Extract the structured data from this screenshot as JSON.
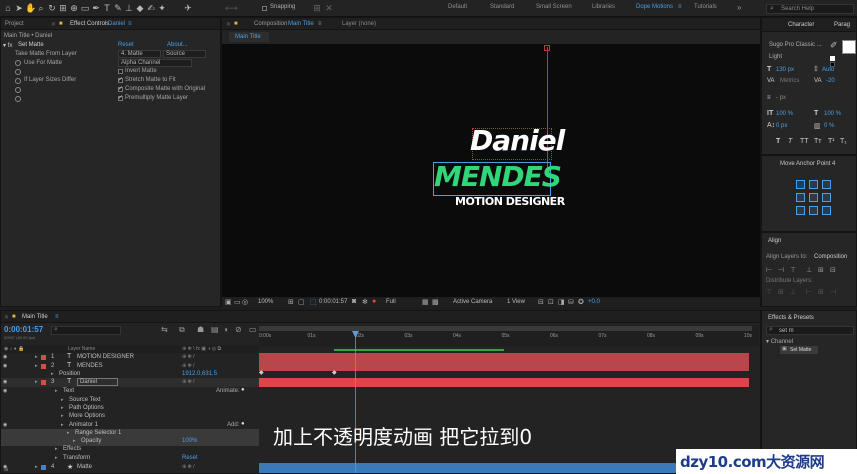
{
  "toolbar": {
    "snapping": "Snapping",
    "workspaces": [
      "Default",
      "Standard",
      "Small Screen",
      "Libraries",
      "Dope Motions",
      "Tutorials"
    ],
    "active_workspace": "Dope Motions",
    "search_placeholder": "Search Help"
  },
  "project_panel": {
    "tab": "Project"
  },
  "effect_controls": {
    "tab_prefix": "Effect Controls",
    "tab_layer": "Daniel",
    "breadcrumb": "Main Title • Daniel",
    "effect_name": "Set Matte",
    "reset": "Reset",
    "about": "About...",
    "take_matte_label": "Take Matte From Layer",
    "take_matte_value": "4. Matte",
    "take_matte_source": "Source",
    "use_for_matte_label": "Use For Matte",
    "use_for_matte_value": "Alpha Channel",
    "invert_matte": "Invert Matte",
    "if_layer_sizes_differ": "If Layer Sizes Differ",
    "stretch_matte": "Stretch Matte to Fit",
    "composite_matte": "Composite Matte with Original",
    "premultiply": "Premultiply Matte Layer"
  },
  "composition": {
    "tab_prefix": "Composition",
    "tab_name": "Main Title",
    "layer_tab": "Layer (none)",
    "sub_tab": "Main Title",
    "title_line1": "Daniel",
    "title_line2": "MENDES",
    "title_line3": "MOTION DESIGNER",
    "zoom": "100%",
    "timecode": "0:00:01:57",
    "resolution": "Full",
    "camera": "Active Camera",
    "view": "1 View",
    "exposure": "+0.0"
  },
  "character": {
    "tab": "Character",
    "tab2": "Parag",
    "font": "Sugo Pro Classic ...",
    "style": "Light",
    "size": "130 px",
    "leading": "Auto",
    "tracking": "-20",
    "kerning_label": "Metrics",
    "stroke_unit": "- px",
    "vscale": "100 %",
    "hscale": "100 %",
    "baseline": "0 px",
    "tsume": "0 %",
    "styles": [
      "T",
      "T",
      "TT",
      "Tт",
      "T¹",
      "T₁"
    ]
  },
  "move_anchor": {
    "title": "Move Anchor Point 4"
  },
  "align": {
    "tab": "Align",
    "align_to_label": "Align Layers to:",
    "align_to_value": "Composition",
    "distribute": "Distribute Layers:"
  },
  "effects_presets": {
    "tab": "Effects & Presets",
    "search_value": "set m",
    "category": "Channel",
    "item": "Set Matte"
  },
  "timeline": {
    "tab": "Main Title",
    "timecode": "0:00:01:57",
    "frame_info": "00097 (60.00 fps)",
    "ruler_labels": [
      "0:00s",
      "01s",
      "02s",
      "03s",
      "04s",
      "05s",
      "06s",
      "07s",
      "08s",
      "09s",
      "10s"
    ],
    "col_layer_name": "Layer Name",
    "layers": [
      {
        "num": "1",
        "name": "MOTION DESIGNER",
        "label_color": "#d94b4b"
      },
      {
        "num": "2",
        "name": "MENDES",
        "label_color": "#d94b4b"
      },
      {
        "num": "",
        "name": "Position",
        "value": "1912.0,631.5"
      },
      {
        "num": "3",
        "name": "Daniel",
        "label_color": "#d94b4b"
      },
      {
        "num": "",
        "name": "Text",
        "animate": "Animate:"
      },
      {
        "num": "",
        "name": "Source Text"
      },
      {
        "num": "",
        "name": "Path Options"
      },
      {
        "num": "",
        "name": "More Options"
      },
      {
        "num": "",
        "name": "Animator 1",
        "add": "Add:"
      },
      {
        "num": "",
        "name": "Range Selector 1"
      },
      {
        "num": "",
        "name": "Opacity",
        "value": "100%"
      },
      {
        "num": "",
        "name": "Effects"
      },
      {
        "num": "",
        "name": "Transform",
        "reset": "Reset"
      },
      {
        "num": "4",
        "name": "Matte",
        "label_color": "#4a7fc1"
      }
    ]
  },
  "subtitle": "加上不透明度动画 把它拉到0",
  "watermark": "dzy10.com大资源网",
  "colors": {
    "accent": "#4a9fe6",
    "title_green": "#2fd77a",
    "layer_red": "#b8474c",
    "layer_red_bright": "#e0444b",
    "matte_blue": "#3c79b8"
  }
}
